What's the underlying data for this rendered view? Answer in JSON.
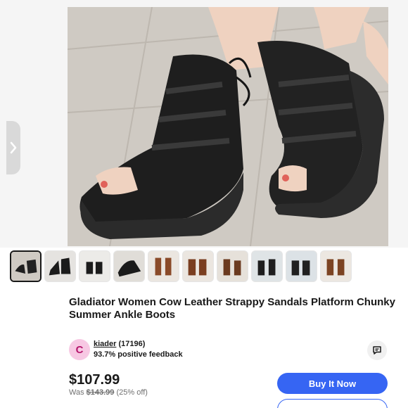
{
  "listing": {
    "title": "Gladiator Women Cow Leather Strappy Sandals Platform Chunky Summer Ankle Boots",
    "thumbnail_count": 10,
    "selected_thumbnail": 1
  },
  "seller": {
    "avatar_letter": "C",
    "name": "kiader",
    "feedback_count": "(17196)",
    "feedback_text": "93.7% positive feedback"
  },
  "pricing": {
    "price": "$107.99",
    "was_label": "Was",
    "original_price": "$143.99",
    "discount": "(25% off)"
  },
  "actions": {
    "buy_now_label": "Buy It Now"
  },
  "icons": {
    "prev": "chevron-right-icon",
    "message": "message-icon"
  },
  "colors": {
    "accent": "#3665f3",
    "avatar_bg": "#f7c8e3",
    "avatar_fg": "#b5166d"
  }
}
